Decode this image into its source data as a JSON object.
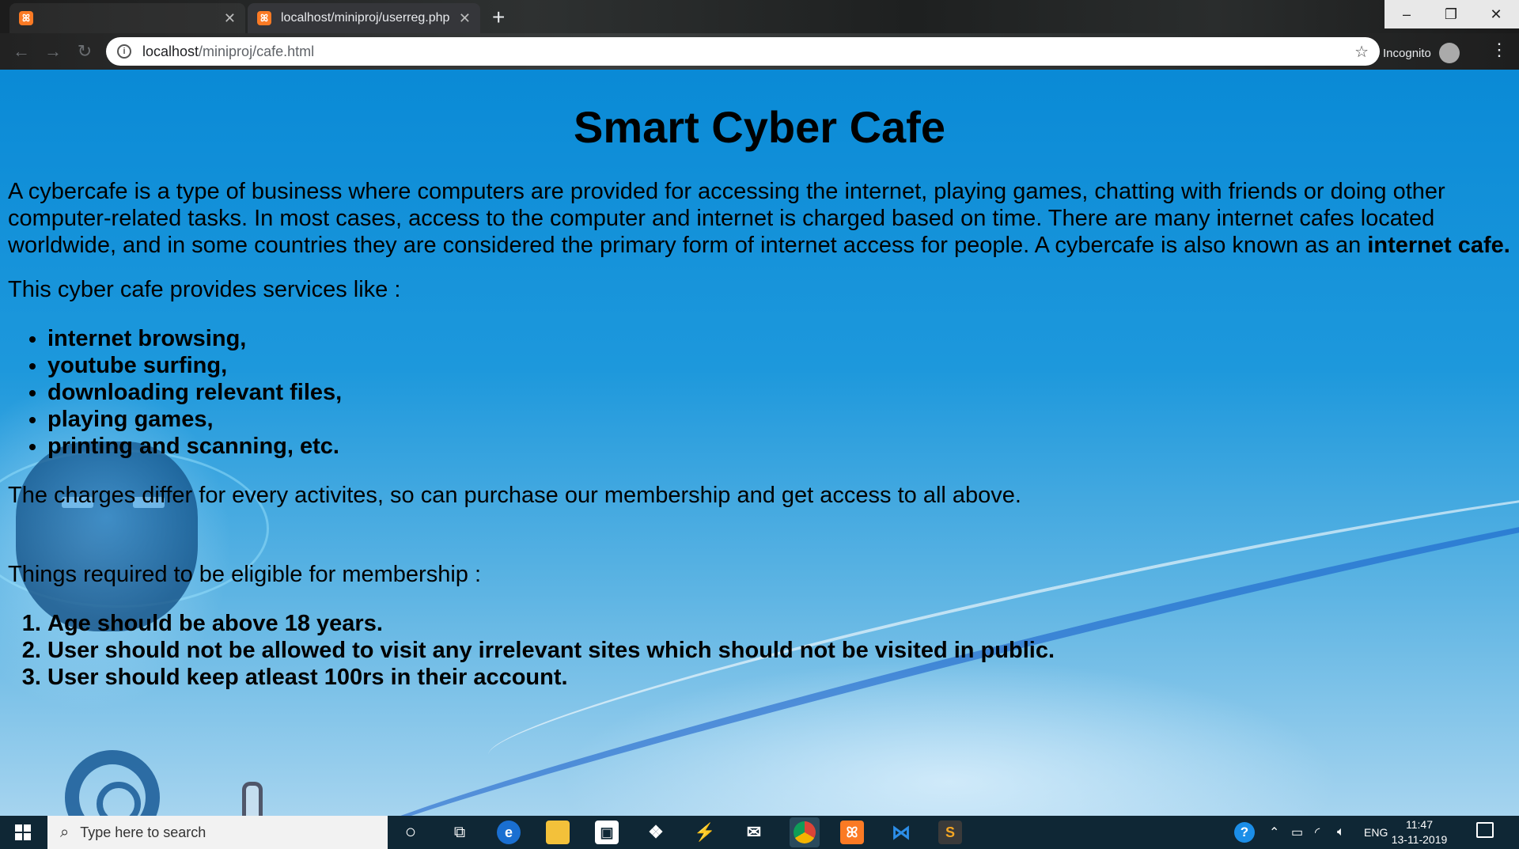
{
  "browser": {
    "tabs": [
      {
        "label": "",
        "active": false
      },
      {
        "label": "localhost/miniproj/userreg.php",
        "active": true
      }
    ],
    "favicon_glyph": "ꕤ",
    "new_tab": "+",
    "window_controls": {
      "minimize": "–",
      "maximize": "❐",
      "close": "✕"
    },
    "url_host": "localhost",
    "url_path": "/miniproj/cafe.html",
    "incognito_label": "Incognito"
  },
  "page": {
    "title": "Smart Cyber Cafe",
    "intro": "A cybercafe is a type of business where computers are provided for accessing the internet, playing games, chatting with friends or doing other computer-related tasks. In most cases, access to the computer and internet is charged based on time. There are many internet cafes located worldwide, and in some countries they are considered the primary form of internet access for people. A cybercafe is also known as an ",
    "intro_bold": "internet cafe.",
    "services_intro": "This cyber cafe provides services like :",
    "services": [
      "internet browsing,",
      "youtube surfing,",
      "downloading relevant files,",
      "playing games,",
      "printing and scanning, etc."
    ],
    "charges": "The charges differ for every activites, so can purchase our membership and get access to all above.",
    "requirements_intro": "Things required to be eligible for membership :",
    "requirements": [
      "Age should be above 18 years.",
      "User should not be allowed to visit any irrelevant sites which should not be visited in public.",
      "User should keep atleast 100rs in their account."
    ]
  },
  "taskbar": {
    "search_placeholder": "Type here to search",
    "language": "ENG",
    "time": "11:47",
    "date": "13-11-2019",
    "accent_colors": {
      "chrome_bg": "#35363a",
      "taskbar_bg": "#0f2735",
      "page_blue": "#0a8ad6"
    }
  }
}
